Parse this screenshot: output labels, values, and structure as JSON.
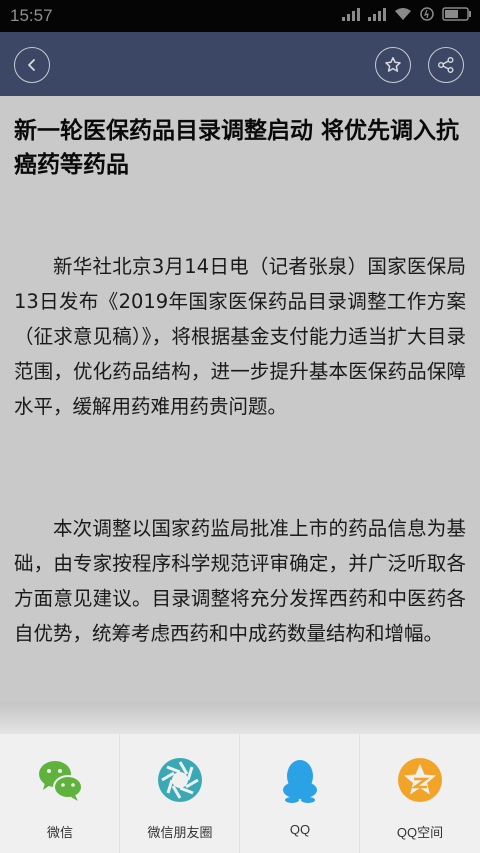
{
  "status_bar": {
    "time": "15:57"
  },
  "article": {
    "title": "新一轮医保药品目录调整启动 将优先调入抗癌药等药品",
    "paragraphs": [
      "新华社北京3月14日电（记者张泉）国家医保局13日发布《2019年国家医保药品目录调整工作方案（征求意见稿）》，将根据基金支付能力适当扩大目录范围，优化药品结构，进一步提升基本医保药品保障水平，缓解用药难用药贵问题。",
      "本次调整以国家药监局批准上市的药品信息为基础，由专家按程序科学规范评审确定，并广泛听取各方面意见建议。目录调整将充分发挥西药和中医药各自优势，统筹考虑西药和中成药数量结构和增幅。"
    ]
  },
  "share_sheet": {
    "items": [
      {
        "label": "微信",
        "icon": "wechat-icon",
        "color": "#5fb33d"
      },
      {
        "label": "微信朋友圈",
        "icon": "wechat-moments-icon",
        "color": "#3aa9b5"
      },
      {
        "label": "QQ",
        "icon": "qq-icon",
        "color": "#2ba1e6"
      },
      {
        "label": "QQ空间",
        "icon": "qzone-icon",
        "color": "#f2a428"
      }
    ]
  },
  "colors": {
    "header": "#3b4764",
    "dim_overlay": "#c9c9c9",
    "sheet_bg": "#f0f0f0"
  }
}
